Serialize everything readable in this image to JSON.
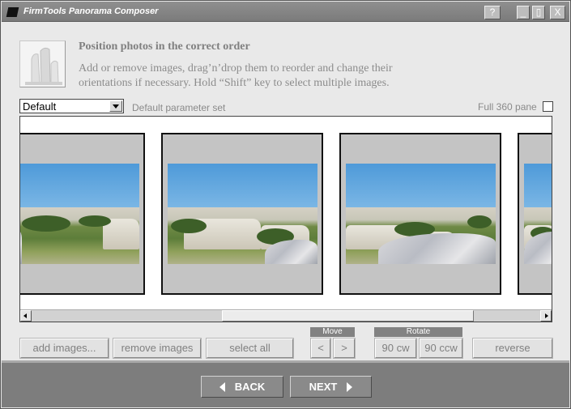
{
  "window": {
    "title": "FirmTools Panorama Composer",
    "help_label": "?",
    "minimize_label": "_",
    "maximize_label": "▯",
    "close_label": "X"
  },
  "header": {
    "title": "Position photos in the correct order",
    "description": "Add or remove images, drag’n’drop them to reorder and change their orientations if necessary. Hold “Shift” key to select multiple images.",
    "icon": "photo-stack-icon"
  },
  "params": {
    "selected": "Default",
    "label": "Default parameter set",
    "full360_label": "Full 360 pane",
    "full360_checked": false
  },
  "strip": {
    "thumbnails": [
      "photo-1",
      "photo-2",
      "photo-3",
      "photo-4"
    ]
  },
  "actions": {
    "add": "add images...",
    "remove": "remove images",
    "select_all": "select all",
    "move_group": "Move",
    "move_left": "<",
    "move_right": ">",
    "rotate_group": "Rotate",
    "rotate_cw": "90 cw",
    "rotate_ccw": "90 ccw",
    "reverse": "reverse"
  },
  "nav": {
    "back": "BACK",
    "next": "NEXT"
  },
  "colors": {
    "title_bar": "#7b7b7b",
    "footer": "#7d7d7d",
    "dialog_bg": "#e9e9e9"
  }
}
